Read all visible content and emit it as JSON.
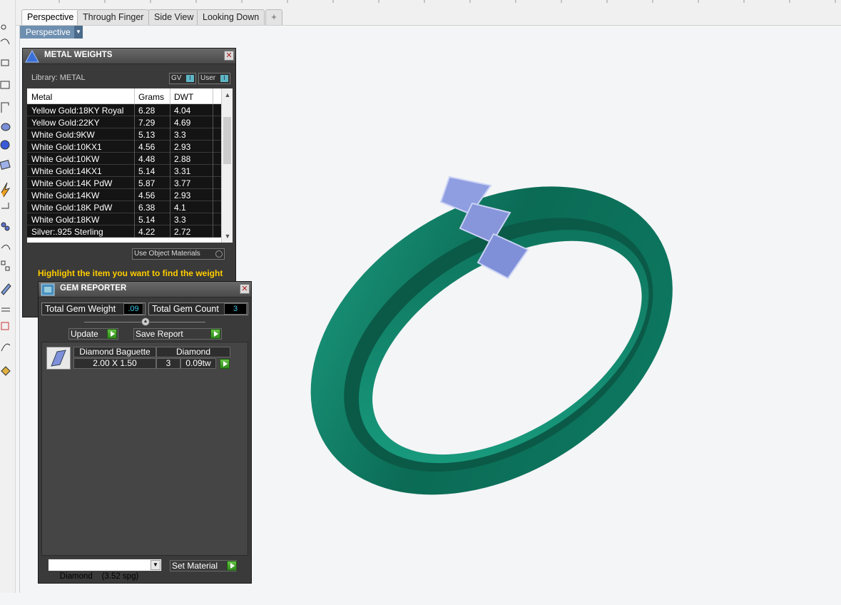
{
  "tabs": [
    {
      "label": "Perspective",
      "active": true
    },
    {
      "label": "Through Finger",
      "active": false
    },
    {
      "label": "Side View",
      "active": false
    },
    {
      "label": "Looking Down",
      "active": false
    }
  ],
  "add_tab_icon": "+",
  "viewport": {
    "label": "Perspective",
    "dropdown_icon": "chevron-down-icon"
  },
  "metal_weights": {
    "title": "METAL WEIGHTS",
    "library_label": "Library: METAL",
    "gv_label": "GV",
    "user_label": "User",
    "columns": [
      "Metal",
      "Grams",
      "DWT"
    ],
    "rows": [
      {
        "metal": "Yellow Gold:18KY Royal",
        "grams": "6.28",
        "dwt": "4.04"
      },
      {
        "metal": "Yellow Gold:22KY",
        "grams": "7.29",
        "dwt": "4.69"
      },
      {
        "metal": "White Gold:9KW",
        "grams": "5.13",
        "dwt": "3.3"
      },
      {
        "metal": "White Gold:10KX1",
        "grams": "4.56",
        "dwt": "2.93"
      },
      {
        "metal": "White Gold:10KW",
        "grams": "4.48",
        "dwt": "2.88"
      },
      {
        "metal": "White Gold:14KX1",
        "grams": "5.14",
        "dwt": "3.31"
      },
      {
        "metal": "White Gold:14K PdW",
        "grams": "5.87",
        "dwt": "3.77"
      },
      {
        "metal": "White Gold:14KW",
        "grams": "4.56",
        "dwt": "2.93"
      },
      {
        "metal": "White Gold:18K PdW",
        "grams": "6.38",
        "dwt": "4.1"
      },
      {
        "metal": "White Gold:18KW",
        "grams": "5.14",
        "dwt": "3.3"
      },
      {
        "metal": "Silver:.925 Sterling",
        "grams": "4.22",
        "dwt": "2.72"
      }
    ],
    "use_object_materials_label": "Use Object Materials",
    "hint": "Highlight the item you want to find the weight"
  },
  "gem_reporter": {
    "title": "GEM REPORTER",
    "total_weight_label": "Total Gem Weight",
    "total_weight_value": ".09",
    "total_count_label": "Total Gem Count",
    "total_count_value": "3",
    "update_label": "Update",
    "save_report_label": "Save Report",
    "gem": {
      "name": "Diamond Baguette",
      "material": "Diamond",
      "size": "2.00 X 1.50",
      "count": "3",
      "weight": "0.09tw"
    },
    "material_select": "Diamond    (3.52 spg)",
    "set_material_label": "Set Material"
  },
  "colors": {
    "ring": "#0f7a63",
    "ring_highlight": "#1fa386",
    "gem": "#8f9ee0",
    "panel_bg": "#3a3a3a",
    "hint_text": "#ffcc00",
    "value_text": "#3cc7e8",
    "viewport_label_bg": "#6f8fb0"
  }
}
